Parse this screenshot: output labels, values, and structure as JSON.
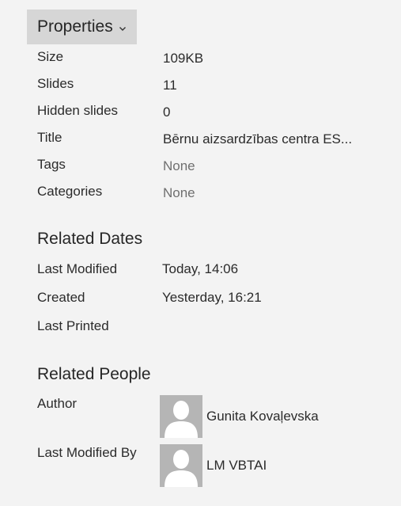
{
  "properties": {
    "header_label": "Properties",
    "size_label": "Size",
    "size_value": "109KB",
    "slides_label": "Slides",
    "slides_value": "11",
    "hidden_label": "Hidden slides",
    "hidden_value": "0",
    "title_label": "Title",
    "title_value": "Bērnu aizsardzības centra ES...",
    "tags_label": "Tags",
    "tags_value": "None",
    "categories_label": "Categories",
    "categories_value": "None"
  },
  "dates": {
    "heading": "Related Dates",
    "modified_label": "Last Modified",
    "modified_value": "Today, 14:06",
    "created_label": "Created",
    "created_value": "Yesterday, 16:21",
    "printed_label": "Last Printed"
  },
  "people": {
    "heading": "Related People",
    "author_label": "Author",
    "author_name": "Gunita Kovaļevska",
    "modified_by_label": "Last Modified By",
    "modified_by_name": "LM VBTAI"
  },
  "icons": {
    "chevron": "chevron-down-icon",
    "avatar": "person-silhouette-icon"
  },
  "colors": {
    "background": "#f3f3f3",
    "header_bg": "#d6d6d6",
    "avatar_bg": "#b5b5b5",
    "muted_text": "#6f6f6f"
  }
}
